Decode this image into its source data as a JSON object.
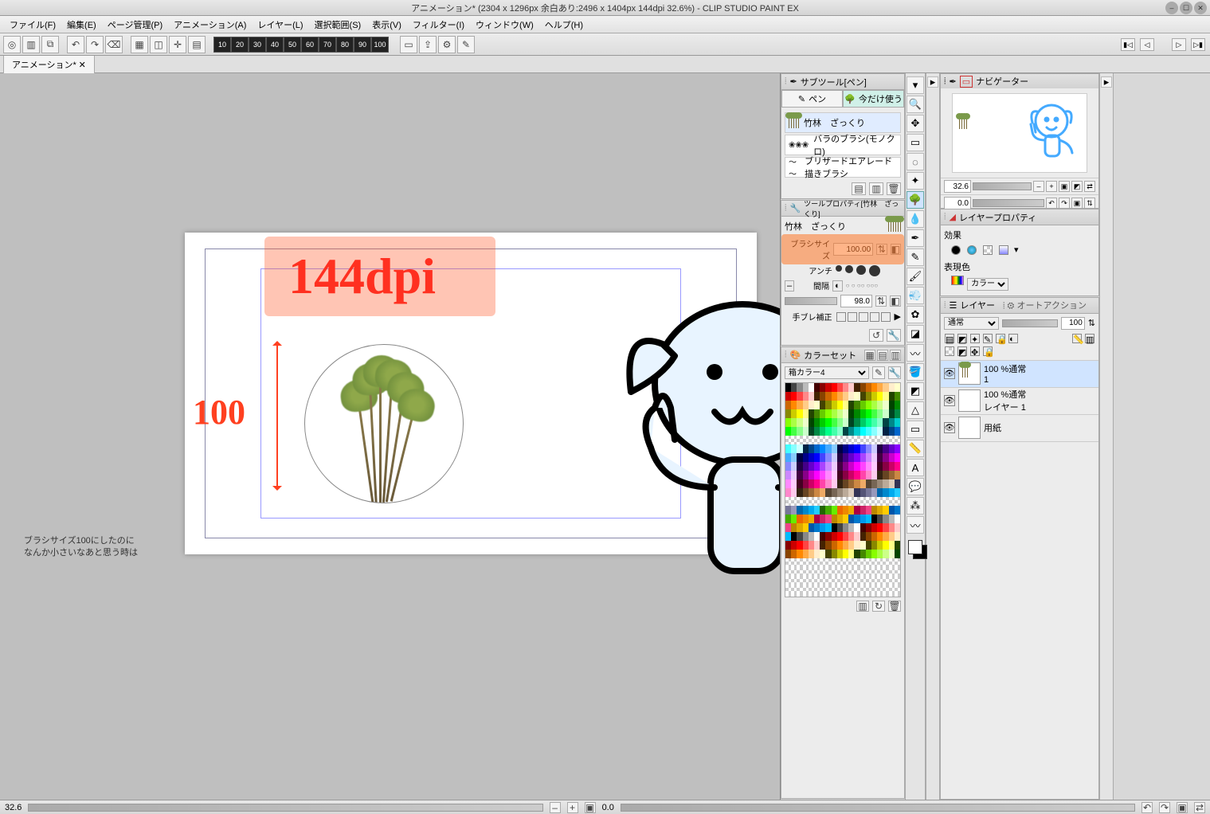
{
  "title": "アニメーション* (2304 x 1296px 余白あり:2496 x 1404px 144dpi 32.6%)  - CLIP STUDIO PAINT EX",
  "menu": [
    "ファイル(F)",
    "編集(E)",
    "ページ管理(P)",
    "アニメーション(A)",
    "レイヤー(L)",
    "選択範囲(S)",
    "表示(V)",
    "フィルター(I)",
    "ウィンドウ(W)",
    "ヘルプ(H)"
  ],
  "percent_presets": [
    "10",
    "20",
    "30",
    "40",
    "50",
    "60",
    "70",
    "80",
    "90",
    "100"
  ],
  "tab": "アニメーション*",
  "canvas": {
    "dpi_text": "144dpi",
    "size_text": "100"
  },
  "overlay_line1": "ブラシサイズ100にしたのに",
  "overlay_line2": "なんか小さいなあと思う時は",
  "panels": {
    "subtool_title": "サブツール[ペン]",
    "subtool_tab1": "ペン",
    "subtool_tab2": "今だけ使う",
    "brushes": [
      "竹林　ざっくり",
      "バラのブラシ(モノクロ)",
      "ブリザードエアレード描きブラシ"
    ],
    "toolprop_title": "ツールプロパティ[竹林　ざっくり]",
    "toolprop_name": "竹林　ざっくり",
    "brush_size_label": "ブラシサイズ",
    "brush_size_value": "100.00",
    "anti_label": "アンチ",
    "gap_label": "間隔",
    "gap_value": "98.0",
    "stabilize_label": "手ブレ補正",
    "colorset_title": "カラーセット",
    "colorset_name": "箱カラー4",
    "navigator_title": "ナビゲーター",
    "nav_zoom": "32.6",
    "nav_rot": "0.0",
    "layerprop_title": "レイヤープロパティ",
    "lp_effect": "効果",
    "lp_expr": "表現色",
    "lp_color": "カラー",
    "layer_title": "レイヤー",
    "autoaction_title": "オートアクション",
    "blend_mode": "通常",
    "opacity": "100",
    "layers": [
      {
        "name": "100 %通常",
        "sub": "1"
      },
      {
        "name": "100 %通常",
        "sub": "レイヤー 1"
      },
      {
        "name": "",
        "sub": "用紙"
      }
    ]
  },
  "status": {
    "zoom": "32.6",
    "rot": "0.0"
  }
}
